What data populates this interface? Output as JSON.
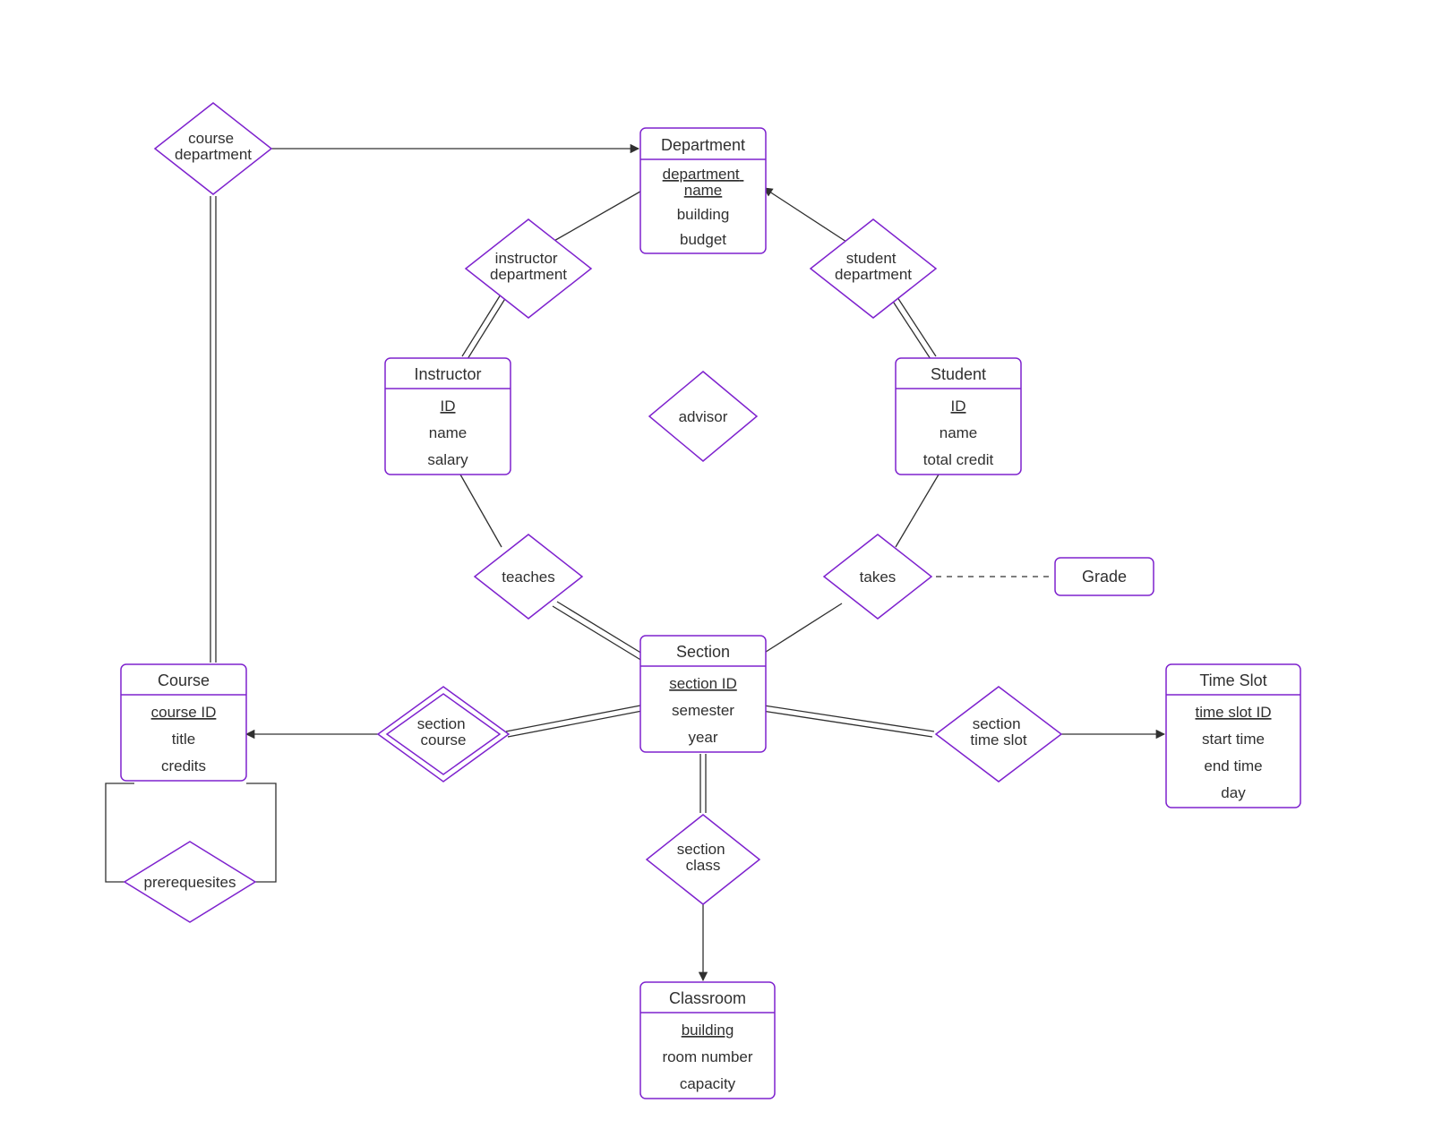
{
  "entities": {
    "department": {
      "title": "Department",
      "attrs": [
        "department name",
        "building",
        "budget"
      ],
      "key": 0
    },
    "instructor": {
      "title": "Instructor",
      "attrs": [
        "ID",
        "name",
        "salary"
      ],
      "key": 0
    },
    "student": {
      "title": "Student",
      "attrs": [
        "ID",
        "name",
        "total credit"
      ],
      "key": 0
    },
    "section": {
      "title": "Section",
      "attrs": [
        "section ID",
        "semester",
        "year"
      ],
      "key": 0
    },
    "course": {
      "title": "Course",
      "attrs": [
        "course ID",
        "title",
        "credits"
      ],
      "key": 0
    },
    "timeslot": {
      "title": "Time Slot",
      "attrs": [
        "time slot ID",
        "start time",
        "end time",
        "day"
      ],
      "key": 0
    },
    "classroom": {
      "title": "Classroom",
      "attrs": [
        "building",
        "room number",
        "capacity"
      ],
      "key": 0
    },
    "grade": {
      "title": "Grade"
    }
  },
  "relations": {
    "course_department": "course department",
    "instructor_department": "instructor department",
    "student_department": "student department",
    "advisor": "advisor",
    "teaches": "teaches",
    "takes": "takes",
    "section_course": "section course",
    "section_time_slot": "section time slot",
    "section_class": "section class",
    "prerequisites": "prerequesites"
  },
  "chart_data": {
    "type": "er-diagram",
    "entities": [
      {
        "name": "Department",
        "key": "department name",
        "attributes": [
          "department name",
          "building",
          "budget"
        ]
      },
      {
        "name": "Instructor",
        "key": "ID",
        "attributes": [
          "ID",
          "name",
          "salary"
        ]
      },
      {
        "name": "Student",
        "key": "ID",
        "attributes": [
          "ID",
          "name",
          "total credit"
        ]
      },
      {
        "name": "Section",
        "key": "section ID",
        "attributes": [
          "section ID",
          "semester",
          "year"
        ]
      },
      {
        "name": "Course",
        "key": "course ID",
        "attributes": [
          "course ID",
          "title",
          "credits"
        ]
      },
      {
        "name": "Time Slot",
        "key": "time slot ID",
        "attributes": [
          "time slot ID",
          "start time",
          "end time",
          "day"
        ]
      },
      {
        "name": "Classroom",
        "key": "building",
        "attributes": [
          "building",
          "room number",
          "capacity"
        ]
      },
      {
        "name": "Grade",
        "attributes": []
      }
    ],
    "relationships": [
      {
        "name": "course department",
        "between": [
          "Course",
          "Department"
        ],
        "cardinality": "many-to-one"
      },
      {
        "name": "instructor department",
        "between": [
          "Instructor",
          "Department"
        ],
        "cardinality": "many-to-one"
      },
      {
        "name": "student department",
        "between": [
          "Student",
          "Department"
        ],
        "cardinality": "many-to-one"
      },
      {
        "name": "advisor",
        "between": [
          "Instructor",
          "Student"
        ]
      },
      {
        "name": "teaches",
        "between": [
          "Instructor",
          "Section"
        ]
      },
      {
        "name": "takes",
        "between": [
          "Student",
          "Section"
        ],
        "attribute_entity": "Grade"
      },
      {
        "name": "section course",
        "between": [
          "Section",
          "Course"
        ],
        "identifying": true,
        "cardinality": "many-to-one"
      },
      {
        "name": "section time slot",
        "between": [
          "Section",
          "Time Slot"
        ],
        "cardinality": "many-to-one"
      },
      {
        "name": "section class",
        "between": [
          "Section",
          "Classroom"
        ],
        "cardinality": "many-to-one"
      },
      {
        "name": "prerequesites",
        "between": [
          "Course",
          "Course"
        ]
      }
    ]
  }
}
